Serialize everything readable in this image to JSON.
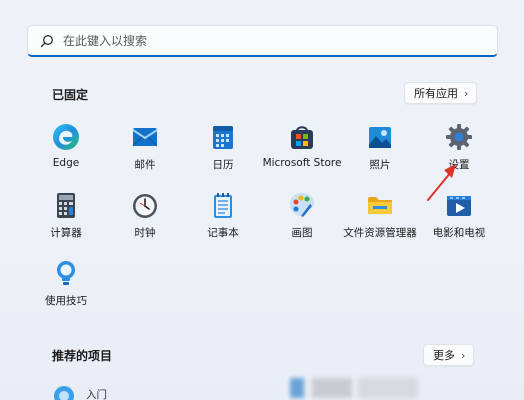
{
  "search": {
    "placeholder": "在此键入以搜索"
  },
  "pinned": {
    "title": "已固定",
    "all_apps_label": "所有应用",
    "apps": [
      {
        "label": "Edge",
        "icon": "edge-icon"
      },
      {
        "label": "邮件",
        "icon": "mail-icon"
      },
      {
        "label": "日历",
        "icon": "calendar-icon"
      },
      {
        "label": "Microsoft Store",
        "icon": "store-icon"
      },
      {
        "label": "照片",
        "icon": "photos-icon"
      },
      {
        "label": "设置",
        "icon": "settings-icon"
      },
      {
        "label": "计算器",
        "icon": "calculator-icon"
      },
      {
        "label": "时钟",
        "icon": "clock-icon"
      },
      {
        "label": "记事本",
        "icon": "notepad-icon"
      },
      {
        "label": "画图",
        "icon": "paint-icon"
      },
      {
        "label": "文件资源管理器",
        "icon": "file-explorer-icon"
      },
      {
        "label": "电影和电视",
        "icon": "movies-tv-icon"
      },
      {
        "label": "使用技巧",
        "icon": "tips-icon"
      }
    ]
  },
  "recommended": {
    "title": "推荐的项目",
    "more_label": "更多",
    "first_item_label": "入门"
  },
  "colors": {
    "accent": "#0067c0",
    "annotation_arrow": "#e0322b"
  }
}
